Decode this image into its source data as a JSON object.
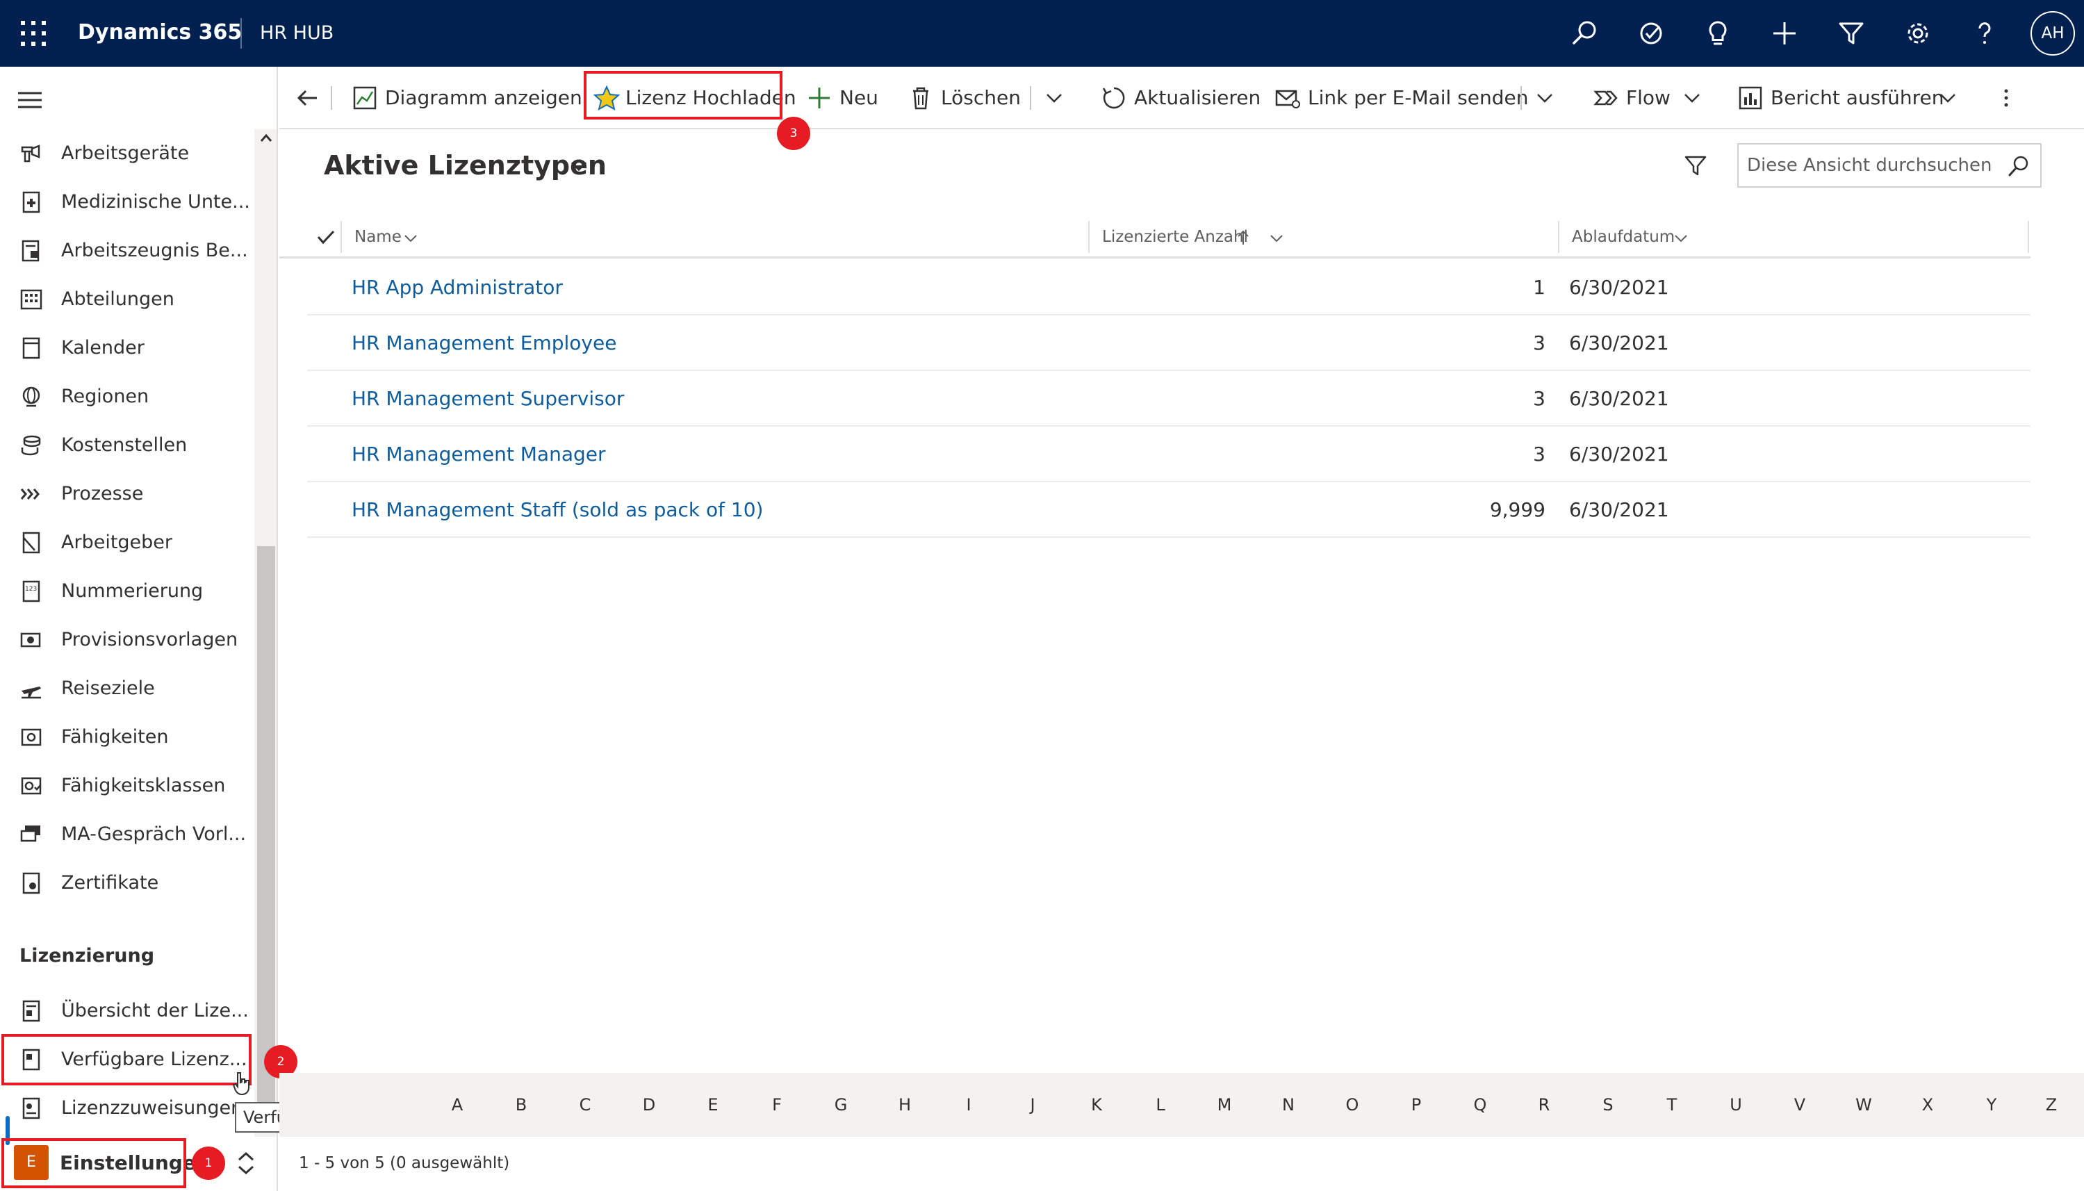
{
  "topbar": {
    "brand": "Dynamics 365",
    "app_name": "HR HUB",
    "avatar_initials": "AH",
    "icons": [
      "search-icon",
      "task-check-icon",
      "lightbulb-icon",
      "plus-icon",
      "filter-icon",
      "settings-gear-icon",
      "help-icon"
    ]
  },
  "sidebar": {
    "items": [
      {
        "label": "Arbeitsgeräte",
        "icon": "tools-icon"
      },
      {
        "label": "Medizinische Unte...",
        "icon": "medical-doc-icon"
      },
      {
        "label": "Arbeitszeugnis Be...",
        "icon": "certificate-doc-icon"
      },
      {
        "label": "Abteilungen",
        "icon": "building-icon"
      },
      {
        "label": "Kalender",
        "icon": "calendar-icon"
      },
      {
        "label": "Regionen",
        "icon": "globe-icon"
      },
      {
        "label": "Kostenstellen",
        "icon": "coins-icon"
      },
      {
        "label": "Prozesse",
        "icon": "process-chevrons-icon"
      },
      {
        "label": "Arbeitgeber",
        "icon": "employer-doc-icon"
      },
      {
        "label": "Nummerierung",
        "icon": "numbering-icon"
      },
      {
        "label": "Provisionsvorlagen",
        "icon": "commission-icon"
      },
      {
        "label": "Reiseziele",
        "icon": "airplane-icon"
      },
      {
        "label": "Fähigkeiten",
        "icon": "skills-icon"
      },
      {
        "label": "Fähigkeitsklassen",
        "icon": "skill-classes-icon"
      },
      {
        "label": "MA-Gespräch Vorl...",
        "icon": "conversation-icon"
      },
      {
        "label": "Zertifikate",
        "icon": "certificate-icon"
      }
    ],
    "section_title": "Lizenzierung",
    "license_items": [
      {
        "label": "Übersicht der Lize...",
        "icon": "license-overview-icon"
      },
      {
        "label": "Verfügbare Lizenz...",
        "icon": "license-available-icon"
      },
      {
        "label": "Lizenzzuweisungen",
        "icon": "license-assign-icon"
      }
    ],
    "tooltip": "Verfügbare Lizenzen",
    "area": {
      "letter": "E",
      "label": "Einstellungen",
      "color": "#d35400"
    }
  },
  "callouts": [
    "1",
    "2",
    "3"
  ],
  "commandbar": {
    "show_chart": "Diagramm anzeigen",
    "upload_license": "Lizenz Hochladen",
    "new": "Neu",
    "delete": "Löschen",
    "refresh": "Aktualisieren",
    "email_link": "Link per E-Mail senden",
    "flow": "Flow",
    "run_report": "Bericht ausführen"
  },
  "view": {
    "title": "Aktive Lizenztypen",
    "search_placeholder": "Diese Ansicht durchsuchen"
  },
  "grid": {
    "columns": {
      "name": "Name",
      "count": "Lizenzierte Anzahl",
      "expiry": "Ablaufdatum"
    },
    "rows": [
      {
        "name": "HR App Administrator",
        "count": "1",
        "expiry": "6/30/2021"
      },
      {
        "name": "HR Management Employee",
        "count": "3",
        "expiry": "6/30/2021"
      },
      {
        "name": "HR Management Supervisor",
        "count": "3",
        "expiry": "6/30/2021"
      },
      {
        "name": "HR Management Manager",
        "count": "3",
        "expiry": "6/30/2021"
      },
      {
        "name": "HR Management Staff (sold as pack of 10)",
        "count": "9,999",
        "expiry": "6/30/2021"
      }
    ]
  },
  "jumpbar": [
    "A",
    "B",
    "C",
    "D",
    "E",
    "F",
    "G",
    "H",
    "I",
    "J",
    "K",
    "L",
    "M",
    "N",
    "O",
    "P",
    "Q",
    "R",
    "S",
    "T",
    "U",
    "V",
    "W",
    "X",
    "Y",
    "Z"
  ],
  "footer": {
    "status": "1 - 5 von 5 (0 ausgewählt)"
  },
  "colors": {
    "nav_bg": "#002050",
    "link": "#0f5c9c",
    "highlight": "#e51c23",
    "accent": "#0f6cbd"
  }
}
